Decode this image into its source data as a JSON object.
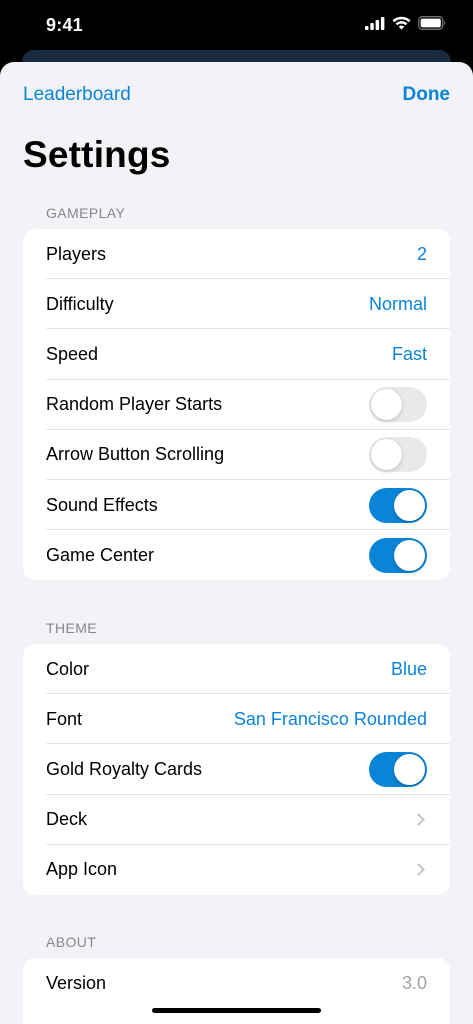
{
  "status_bar": {
    "time": "9:41"
  },
  "nav": {
    "left_label": "Leaderboard",
    "right_label": "Done"
  },
  "title": "Settings",
  "colors": {
    "accent": "#0a84d6",
    "toggle_off": "#e9e9eb"
  },
  "sections": {
    "gameplay": {
      "header": "GAMEPLAY",
      "players": {
        "label": "Players",
        "value": "2"
      },
      "difficulty": {
        "label": "Difficulty",
        "value": "Normal"
      },
      "speed": {
        "label": "Speed",
        "value": "Fast"
      },
      "random_player_starts": {
        "label": "Random Player Starts",
        "on": false
      },
      "arrow_button_scrolling": {
        "label": "Arrow Button Scrolling",
        "on": false
      },
      "sound_effects": {
        "label": "Sound Effects",
        "on": true
      },
      "game_center": {
        "label": "Game Center",
        "on": true
      }
    },
    "theme": {
      "header": "THEME",
      "color": {
        "label": "Color",
        "value": "Blue"
      },
      "font": {
        "label": "Font",
        "value": "San Francisco Rounded"
      },
      "gold_royalty_cards": {
        "label": "Gold Royalty Cards",
        "on": true
      },
      "deck": {
        "label": "Deck",
        "icon": "chevron-right-icon"
      },
      "app_icon": {
        "label": "App Icon",
        "icon": "chevron-right-icon"
      }
    },
    "about": {
      "header": "ABOUT",
      "version": {
        "label": "Version",
        "value": "3.0"
      }
    }
  }
}
